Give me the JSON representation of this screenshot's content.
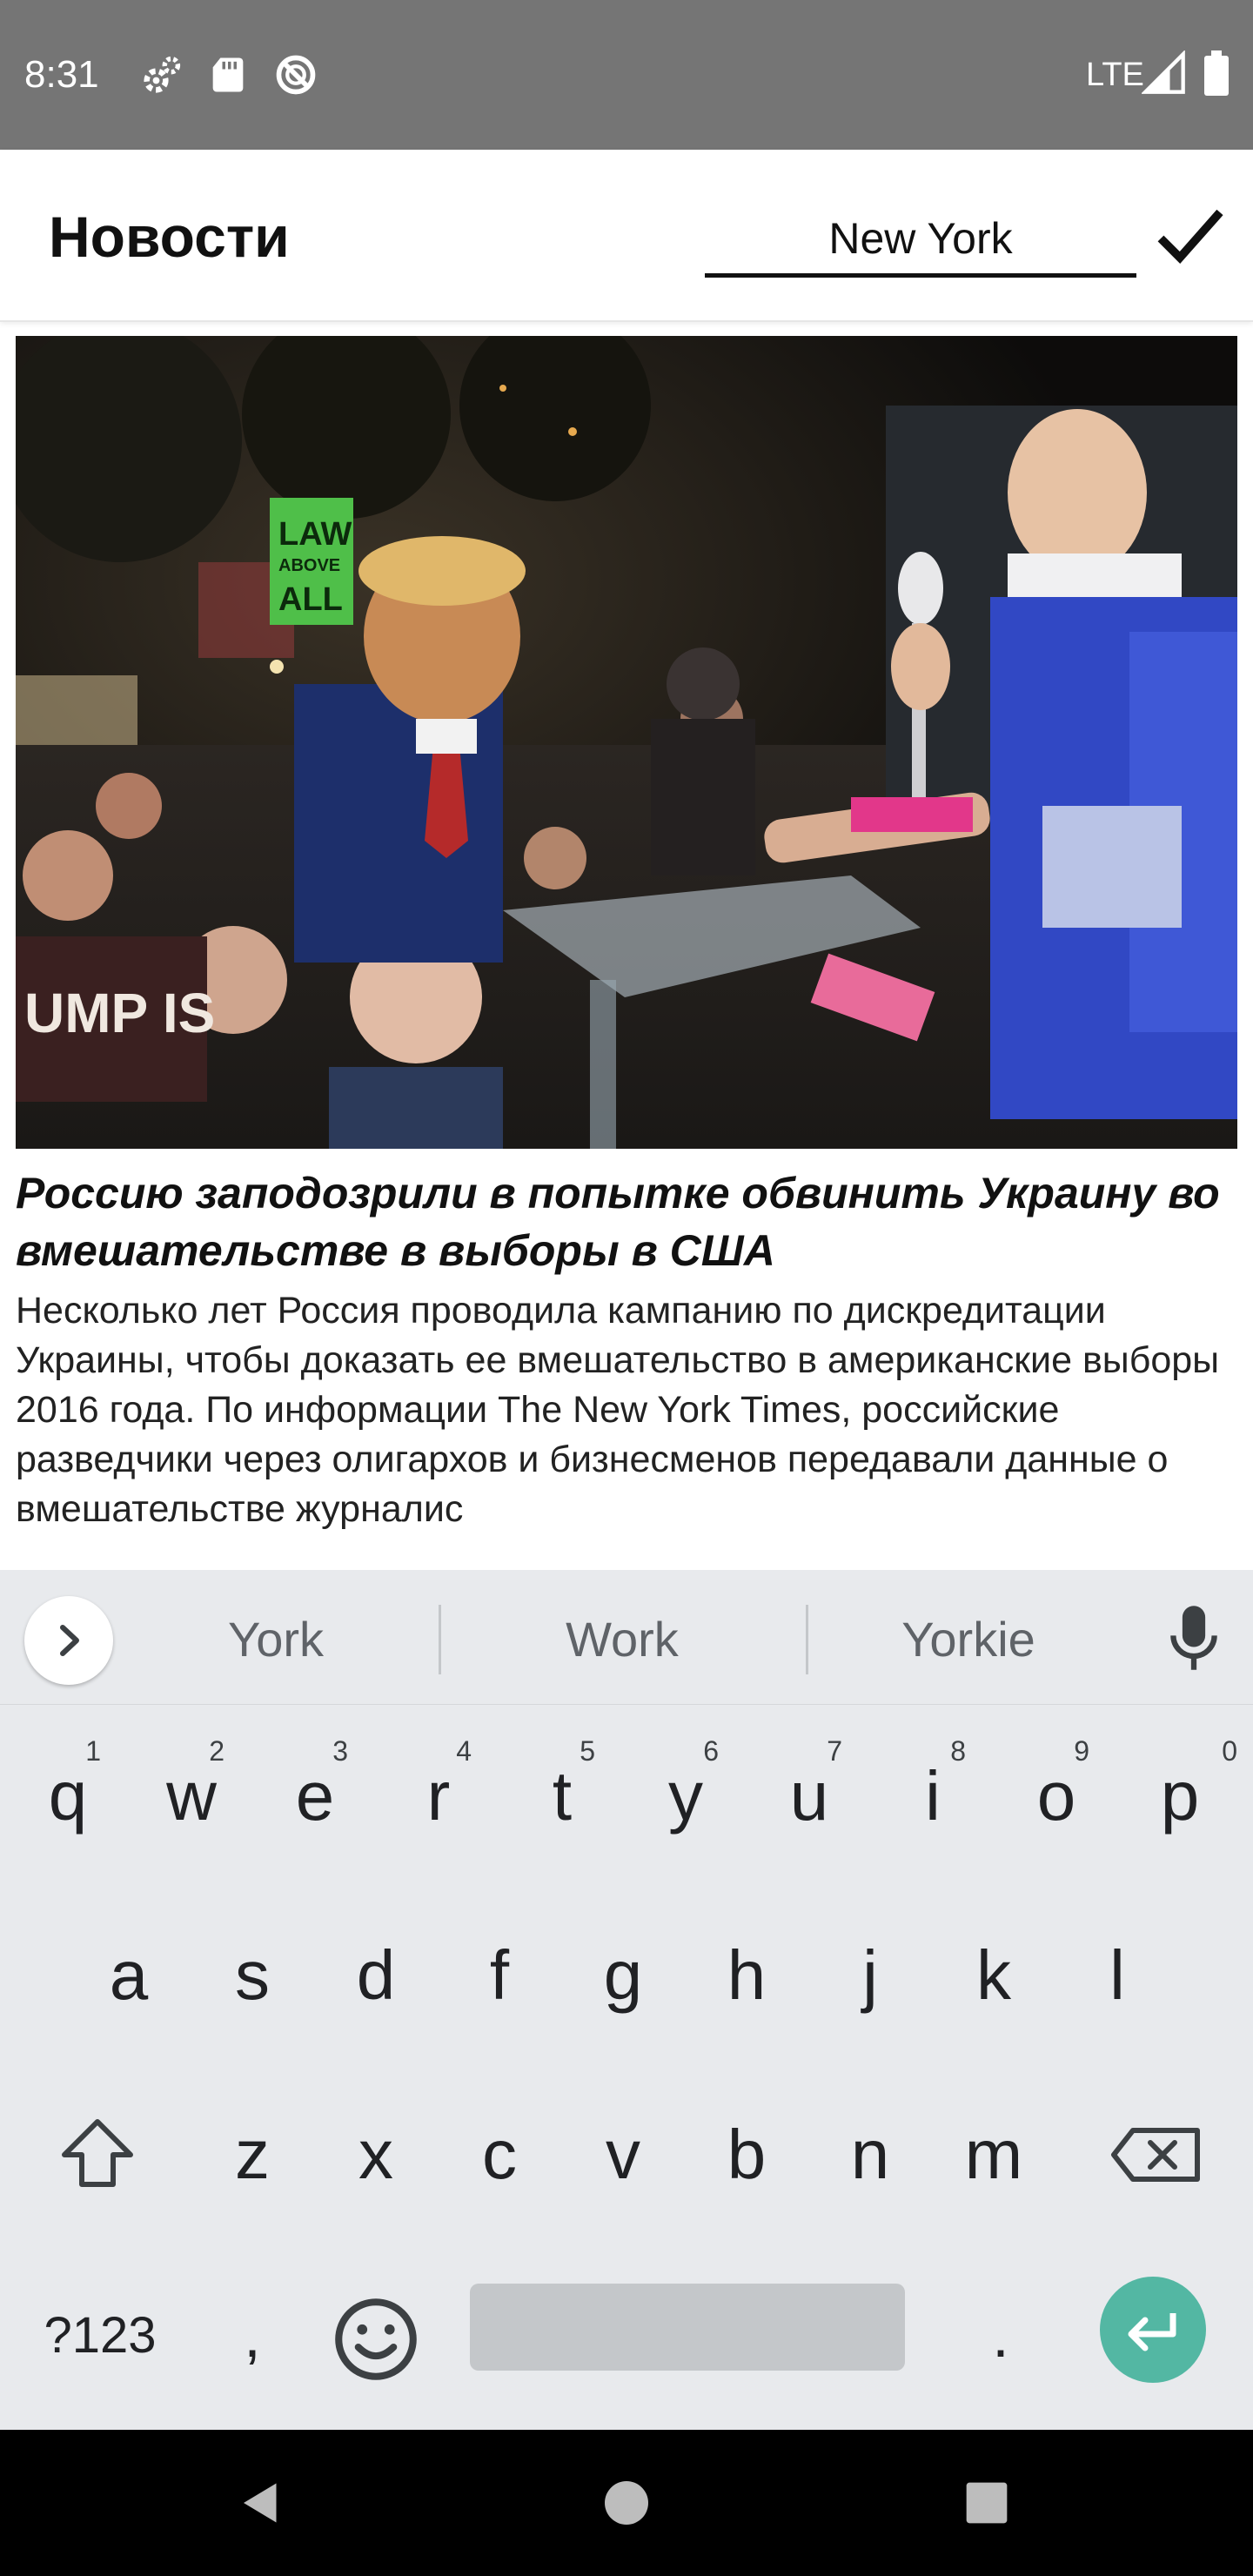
{
  "status_bar": {
    "time": "8:31",
    "network": "LTE",
    "icons": [
      "settings-gear-icon",
      "sd-card-icon",
      "do-not-disturb-icon",
      "signal-icon",
      "battery-icon"
    ]
  },
  "app_bar": {
    "title": "Новости",
    "search_value": "New York",
    "confirm_icon": "checkmark-icon"
  },
  "article": {
    "title": "Россию заподозрили в попытке обвинить Украину во вмешательстве в выборы в США",
    "body": "Несколько лет Россия проводила кампанию по дискредитации Украины, чтобы доказать ее вмешательство в американские выборы 2016 года. По информации The New York Times, российские разведчики через олигархов и бизнесменов передавали данные о вмешательстве журналис"
  },
  "keyboard": {
    "suggestions": [
      "York",
      "Work",
      "Yorkie"
    ],
    "rows": [
      [
        {
          "k": "q",
          "h": "1"
        },
        {
          "k": "w",
          "h": "2"
        },
        {
          "k": "e",
          "h": "3"
        },
        {
          "k": "r",
          "h": "4"
        },
        {
          "k": "t",
          "h": "5"
        },
        {
          "k": "y",
          "h": "6"
        },
        {
          "k": "u",
          "h": "7"
        },
        {
          "k": "i",
          "h": "8"
        },
        {
          "k": "o",
          "h": "9"
        },
        {
          "k": "p",
          "h": "0"
        }
      ],
      [
        {
          "k": "a"
        },
        {
          "k": "s"
        },
        {
          "k": "d"
        },
        {
          "k": "f"
        },
        {
          "k": "g"
        },
        {
          "k": "h"
        },
        {
          "k": "j"
        },
        {
          "k": "k"
        },
        {
          "k": "l"
        }
      ],
      [
        {
          "k": "z"
        },
        {
          "k": "x"
        },
        {
          "k": "c"
        },
        {
          "k": "v"
        },
        {
          "k": "b"
        },
        {
          "k": "n"
        },
        {
          "k": "m"
        }
      ]
    ],
    "symbols_label": "?123",
    "comma": ",",
    "period": ".",
    "accent_color": "#53b7a3"
  },
  "nav_bar": {
    "icons": [
      "back-icon",
      "home-icon",
      "recents-icon"
    ]
  }
}
